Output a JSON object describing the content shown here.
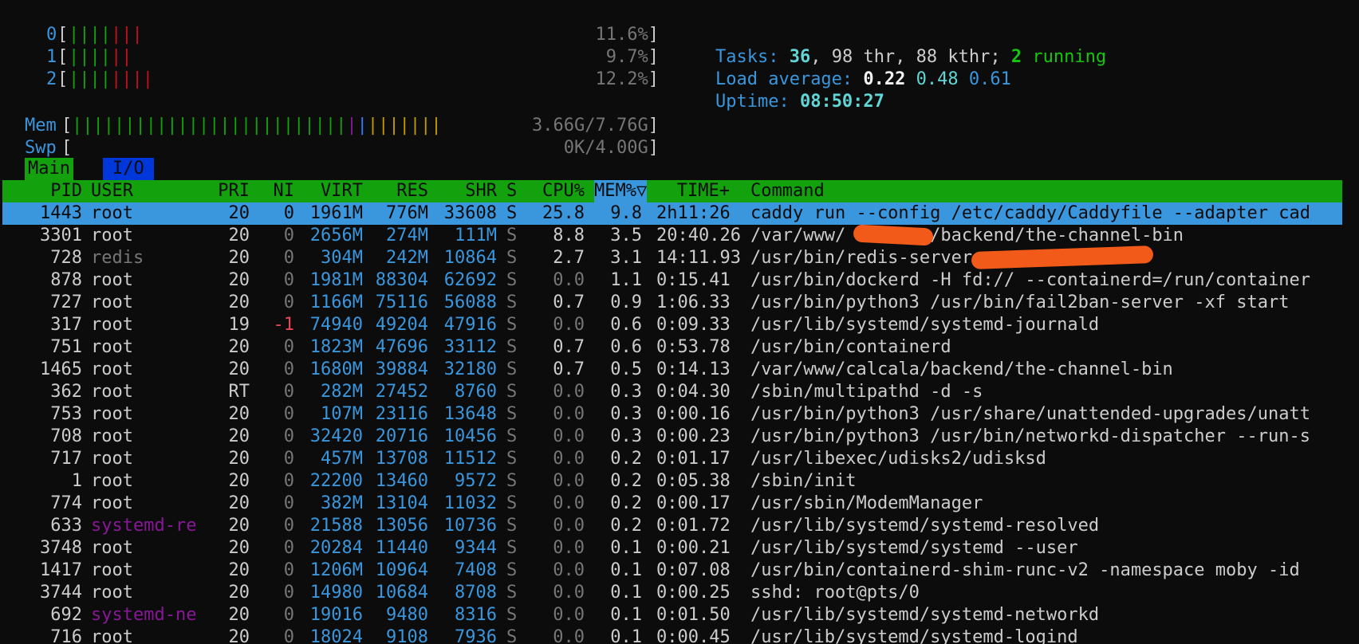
{
  "meters": {
    "cpu": [
      {
        "label": "0",
        "percent": "11.6%",
        "green_bars": "||||",
        "red_bars": "|||"
      },
      {
        "label": "1",
        "percent": "9.7%",
        "green_bars": "||||",
        "red_bars": "||"
      },
      {
        "label": "2",
        "percent": "12.2%",
        "green_bars": "||||",
        "red_bars": "||||"
      }
    ],
    "mem": {
      "label": "Mem",
      "value": "3.66G/7.76G",
      "green_bars": "||||||||||||||||||||||||||",
      "mag_bars": "|",
      "blue_bars": "|",
      "yellow_bars": "|||||||"
    },
    "swp": {
      "label": "Swp",
      "value": "0K/4.00G"
    }
  },
  "info": {
    "tasks_label": "Tasks:",
    "tasks_count": "36",
    "thr_text": ", 98 thr, 88 kthr;",
    "running_count": "2",
    "running_label": "running",
    "load_label": "Load average:",
    "load_1": "0.22",
    "load_5": "0.48",
    "load_15": "0.61",
    "uptime_label": "Uptime:",
    "uptime_value": "08:50:27"
  },
  "tabs": {
    "main": "Main",
    "io": "I/O"
  },
  "columns": {
    "pid": "PID",
    "user": "USER",
    "pri": "PRI",
    "ni": "NI",
    "virt": "VIRT",
    "res": "RES",
    "shr": "SHR",
    "s": "S",
    "cpu": "CPU%",
    "mem": "MEM%▽",
    "time": "TIME+",
    "command": "Command"
  },
  "colors": {
    "background": "#0c0c0c",
    "header_green": "#13a10e",
    "selected_blue": "#3a96dd",
    "redaction_orange": "#f25a1a"
  },
  "processes": [
    {
      "pid": "1443",
      "user": "root",
      "pri": "20",
      "ni": "0",
      "virt": "1961M",
      "res": "776M",
      "shr": "33608",
      "s": "S",
      "cpu": "25.8",
      "mem": "9.8",
      "time": "2h11:26",
      "command": "caddy run --config /etc/caddy/Caddyfile --adapter cad"
    },
    {
      "pid": "3301",
      "user": "root",
      "pri": "20",
      "ni": "0",
      "virt": "2656M",
      "res": "274M",
      "shr": "111M",
      "s": "S",
      "cpu": "8.8",
      "mem": "3.5",
      "time": "20:40.26",
      "command": "/var/www/        /backend/the-channel-bin"
    },
    {
      "pid": "728",
      "user": "redis",
      "pri": "20",
      "ni": "0",
      "virt": "304M",
      "res": "242M",
      "shr": "10864",
      "s": "S",
      "cpu": "2.7",
      "mem": "3.1",
      "time": "14:11.93",
      "command": "/usr/bin/redis-server"
    },
    {
      "pid": "878",
      "user": "root",
      "pri": "20",
      "ni": "0",
      "virt": "1981M",
      "res": "88304",
      "shr": "62692",
      "s": "S",
      "cpu": "0.0",
      "mem": "1.1",
      "time": "0:15.41",
      "command": "/usr/bin/dockerd -H fd:// --containerd=/run/container"
    },
    {
      "pid": "727",
      "user": "root",
      "pri": "20",
      "ni": "0",
      "virt": "1166M",
      "res": "75116",
      "shr": "56088",
      "s": "S",
      "cpu": "0.7",
      "mem": "0.9",
      "time": "1:06.33",
      "command": "/usr/bin/python3 /usr/bin/fail2ban-server -xf start"
    },
    {
      "pid": "317",
      "user": "root",
      "pri": "19",
      "ni": "-1",
      "virt": "74940",
      "res": "49204",
      "shr": "47916",
      "s": "S",
      "cpu": "0.0",
      "mem": "0.6",
      "time": "0:09.33",
      "command": "/usr/lib/systemd/systemd-journald"
    },
    {
      "pid": "751",
      "user": "root",
      "pri": "20",
      "ni": "0",
      "virt": "1823M",
      "res": "47696",
      "shr": "33112",
      "s": "S",
      "cpu": "0.7",
      "mem": "0.6",
      "time": "0:53.78",
      "command": "/usr/bin/containerd"
    },
    {
      "pid": "1465",
      "user": "root",
      "pri": "20",
      "ni": "0",
      "virt": "1680M",
      "res": "39884",
      "shr": "32180",
      "s": "S",
      "cpu": "0.7",
      "mem": "0.5",
      "time": "0:14.13",
      "command": "/var/www/calcala/backend/the-channel-bin"
    },
    {
      "pid": "362",
      "user": "root",
      "pri": "RT",
      "ni": "0",
      "virt": "282M",
      "res": "27452",
      "shr": "8760",
      "s": "S",
      "cpu": "0.0",
      "mem": "0.3",
      "time": "0:04.30",
      "command": "/sbin/multipathd -d -s"
    },
    {
      "pid": "753",
      "user": "root",
      "pri": "20",
      "ni": "0",
      "virt": "107M",
      "res": "23116",
      "shr": "13648",
      "s": "S",
      "cpu": "0.0",
      "mem": "0.3",
      "time": "0:00.16",
      "command": "/usr/bin/python3 /usr/share/unattended-upgrades/unatt"
    },
    {
      "pid": "708",
      "user": "root",
      "pri": "20",
      "ni": "0",
      "virt": "32420",
      "res": "20716",
      "shr": "10456",
      "s": "S",
      "cpu": "0.0",
      "mem": "0.3",
      "time": "0:00.23",
      "command": "/usr/bin/python3 /usr/bin/networkd-dispatcher --run-s"
    },
    {
      "pid": "717",
      "user": "root",
      "pri": "20",
      "ni": "0",
      "virt": "457M",
      "res": "13708",
      "shr": "11512",
      "s": "S",
      "cpu": "0.0",
      "mem": "0.2",
      "time": "0:01.17",
      "command": "/usr/libexec/udisks2/udisksd"
    },
    {
      "pid": "1",
      "user": "root",
      "pri": "20",
      "ni": "0",
      "virt": "22200",
      "res": "13460",
      "shr": "9572",
      "s": "S",
      "cpu": "0.0",
      "mem": "0.2",
      "time": "0:05.38",
      "command": "/sbin/init"
    },
    {
      "pid": "774",
      "user": "root",
      "pri": "20",
      "ni": "0",
      "virt": "382M",
      "res": "13104",
      "shr": "11032",
      "s": "S",
      "cpu": "0.0",
      "mem": "0.2",
      "time": "0:00.17",
      "command": "/usr/sbin/ModemManager"
    },
    {
      "pid": "633",
      "user": "systemd-re",
      "pri": "20",
      "ni": "0",
      "virt": "21588",
      "res": "13056",
      "shr": "10736",
      "s": "S",
      "cpu": "0.0",
      "mem": "0.2",
      "time": "0:01.72",
      "command": "/usr/lib/systemd/systemd-resolved"
    },
    {
      "pid": "3748",
      "user": "root",
      "pri": "20",
      "ni": "0",
      "virt": "20284",
      "res": "11440",
      "shr": "9344",
      "s": "S",
      "cpu": "0.0",
      "mem": "0.1",
      "time": "0:00.21",
      "command": "/usr/lib/systemd/systemd --user"
    },
    {
      "pid": "1417",
      "user": "root",
      "pri": "20",
      "ni": "0",
      "virt": "1206M",
      "res": "10964",
      "shr": "7408",
      "s": "S",
      "cpu": "0.0",
      "mem": "0.1",
      "time": "0:07.08",
      "command": "/usr/bin/containerd-shim-runc-v2 -namespace moby -id"
    },
    {
      "pid": "3744",
      "user": "root",
      "pri": "20",
      "ni": "0",
      "virt": "14980",
      "res": "10684",
      "shr": "8708",
      "s": "S",
      "cpu": "0.0",
      "mem": "0.1",
      "time": "0:00.25",
      "command": "sshd: root@pts/0"
    },
    {
      "pid": "692",
      "user": "systemd-ne",
      "pri": "20",
      "ni": "0",
      "virt": "19016",
      "res": "9480",
      "shr": "8316",
      "s": "S",
      "cpu": "0.0",
      "mem": "0.1",
      "time": "0:01.50",
      "command": "/usr/lib/systemd/systemd-networkd"
    },
    {
      "pid": "716",
      "user": "root",
      "pri": "20",
      "ni": "0",
      "virt": "18024",
      "res": "9108",
      "shr": "7936",
      "s": "S",
      "cpu": "0.0",
      "mem": "0.1",
      "time": "0:00.45",
      "command": "/usr/lib/systemd/systemd-logind"
    }
  ]
}
